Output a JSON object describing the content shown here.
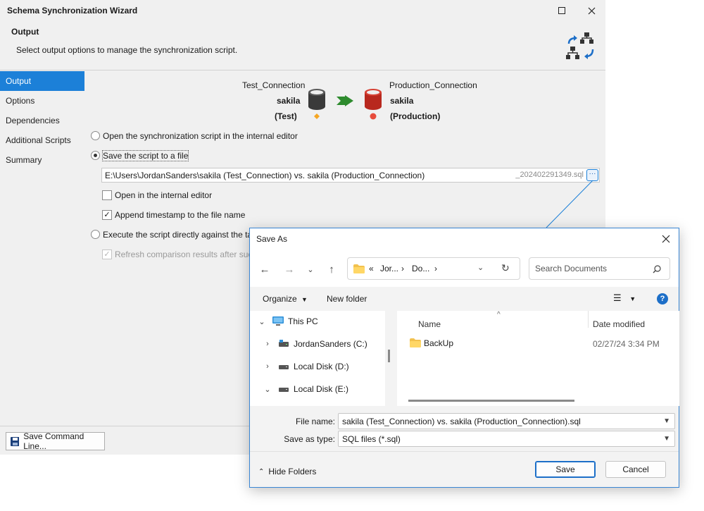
{
  "wizard": {
    "title": "Schema Synchronization Wizard",
    "page_title": "Output",
    "page_description": "Select output options to manage the synchronization script.",
    "nav": [
      "Output",
      "Options",
      "Dependencies",
      "Additional Scripts",
      "Summary"
    ],
    "source": {
      "connection": "Test_Connection",
      "database": "sakila",
      "env": "(Test)",
      "color": "#f5a623"
    },
    "target": {
      "connection": "Production_Connection",
      "database": "sakila",
      "env": "(Production)",
      "color": "#e74c3c"
    },
    "options": {
      "open_internal_editor": "Open the synchronization script in the internal editor",
      "save_to_file": "Save the script to a file",
      "file_path": "E:\\Users\\JordanSanders\\sakila (Test_Connection) vs. sakila (Production_Connection)",
      "file_suffix": "_202402291349.sql",
      "open_in_editor": "Open in the internal editor",
      "append_timestamp": "Append timestamp to the file name",
      "execute_directly": "Execute the script directly against the targe",
      "refresh_comparison": "Refresh comparison results after succes"
    },
    "footer": {
      "save_command_line": "Save Command Line..."
    }
  },
  "save_as": {
    "title": "Save As",
    "breadcrumb": [
      "«",
      "Jor...",
      "Do..."
    ],
    "search_placeholder": "Search Documents",
    "toolbar": {
      "organize": "Organize",
      "new_folder": "New folder"
    },
    "tree": [
      {
        "label": "This PC",
        "icon": "computer-icon"
      },
      {
        "label": "JordanSanders (C:)",
        "icon": "drive-icon"
      },
      {
        "label": "Local Disk (D:)",
        "icon": "drive-icon"
      },
      {
        "label": "Local Disk (E:)",
        "icon": "drive-icon"
      }
    ],
    "columns": {
      "name": "Name",
      "date": "Date modified"
    },
    "files": [
      {
        "name": "BackUp",
        "date": "02/27/24 3:34 PM"
      }
    ],
    "file_name_label": "File name:",
    "file_name_value": "sakila (Test_Connection) vs. sakila (Production_Connection).sql",
    "save_type_label": "Save as type:",
    "save_type_value": "SQL files (*.sql)",
    "hide_folders": "Hide Folders",
    "save_button": "Save",
    "cancel_button": "Cancel"
  }
}
